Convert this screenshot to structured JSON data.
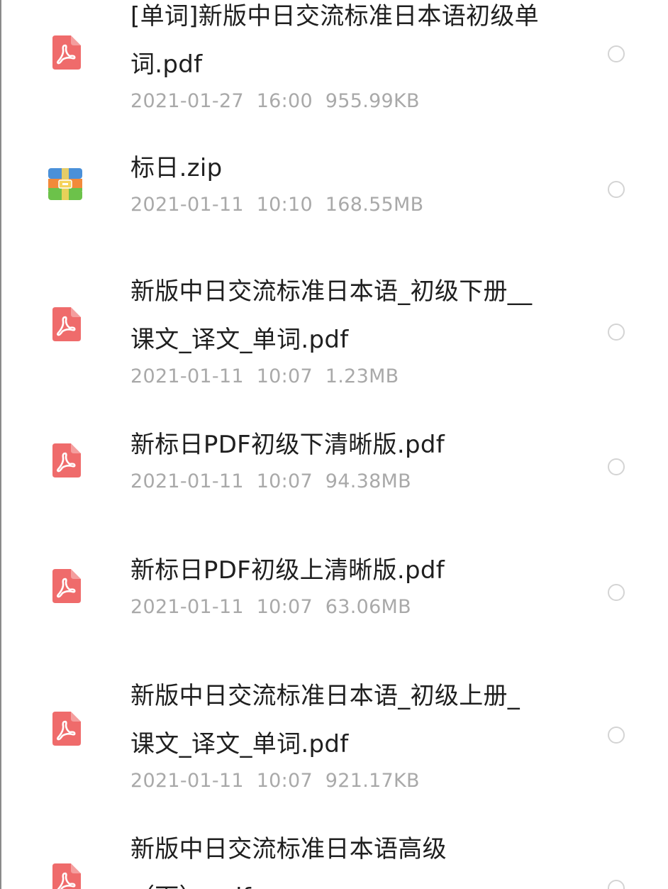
{
  "files": [
    {
      "name_lines": [
        "[单词]新版中日交流标准日本语初级单",
        "词.pdf"
      ],
      "date": "2021-01-27",
      "time": "16:00",
      "size": "955.99KB",
      "type": "pdf",
      "icon": "pdf-file-icon"
    },
    {
      "name_lines": [
        "标日.zip"
      ],
      "date": "2021-01-11",
      "time": "10:10",
      "size": "168.55MB",
      "type": "zip",
      "icon": "zip-archive-icon"
    },
    {
      "name_lines": [
        "新版中日交流标准日本语_初级下册__",
        "课文_译文_单词.pdf"
      ],
      "date": "2021-01-11",
      "time": "10:07",
      "size": "1.23MB",
      "type": "pdf",
      "icon": "pdf-file-icon"
    },
    {
      "name_lines": [
        "新标日PDF初级下清晰版.pdf"
      ],
      "date": "2021-01-11",
      "time": "10:07",
      "size": "94.38MB",
      "type": "pdf",
      "icon": "pdf-file-icon"
    },
    {
      "name_lines": [
        "新标日PDF初级上清晰版.pdf"
      ],
      "date": "2021-01-11",
      "time": "10:07",
      "size": "63.06MB",
      "type": "pdf",
      "icon": "pdf-file-icon"
    },
    {
      "name_lines": [
        "新版中日交流标准日本语_初级上册_",
        "课文_译文_单词.pdf"
      ],
      "date": "2021-01-11",
      "time": "10:07",
      "size": "921.17KB",
      "type": "pdf",
      "icon": "pdf-file-icon"
    },
    {
      "name_lines": [
        "新版中日交流标准日本语高级",
        "（下）.pdf"
      ],
      "date": "",
      "time": "",
      "size": "",
      "type": "pdf",
      "icon": "pdf-file-icon"
    }
  ],
  "colors": {
    "pdf_icon": "#ef6b6b",
    "zip_blue": "#4a90d9",
    "zip_orange": "#f28a3a",
    "zip_green": "#6cc24a",
    "zip_clasp": "#f5d35b",
    "name_text": "#1f1f1f",
    "meta_text": "#a9a9a9",
    "select_circle": "#d4d4d4"
  }
}
